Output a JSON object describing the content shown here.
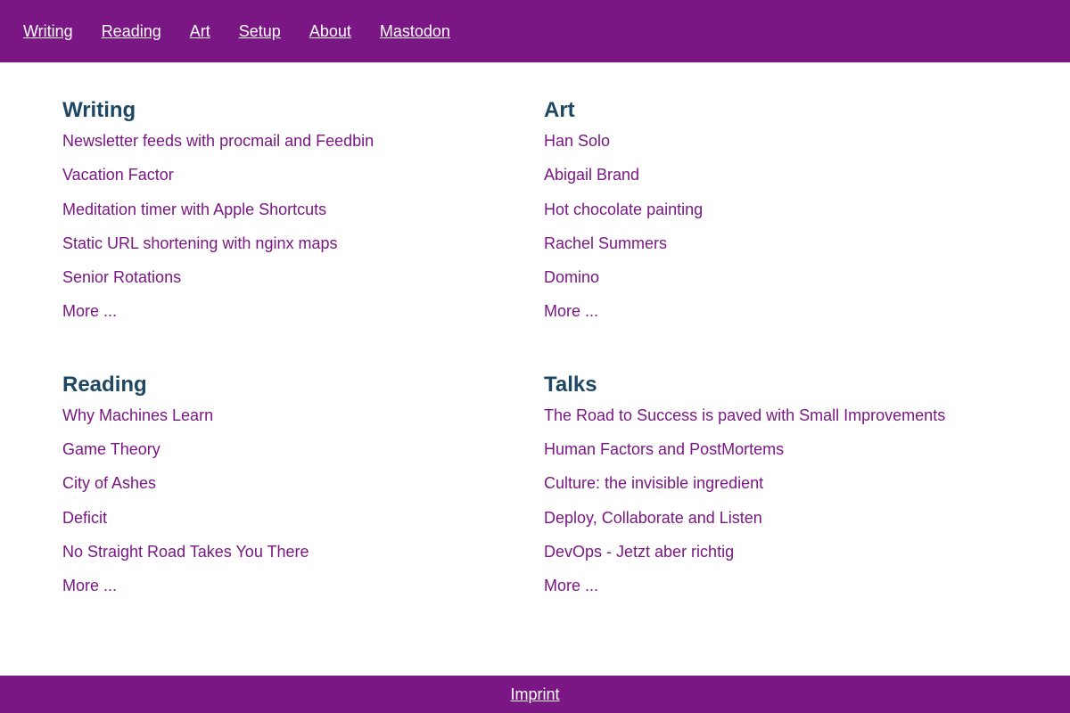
{
  "nav": {
    "items": [
      {
        "label": "Writing"
      },
      {
        "label": "Reading"
      },
      {
        "label": "Art"
      },
      {
        "label": "Setup"
      },
      {
        "label": "About"
      },
      {
        "label": "Mastodon"
      }
    ]
  },
  "sections": {
    "writing": {
      "title": "Writing",
      "items": [
        "Newsletter feeds with procmail and Feedbin",
        "Vacation Factor",
        "Meditation timer with Apple Shortcuts",
        "Static URL shortening with nginx maps",
        "Senior Rotations"
      ],
      "more": "More ..."
    },
    "art": {
      "title": "Art",
      "items": [
        "Han Solo",
        "Abigail Brand",
        "Hot chocolate painting",
        "Rachel Summers",
        "Domino"
      ],
      "more": "More ..."
    },
    "reading": {
      "title": "Reading",
      "items": [
        "Why Machines Learn",
        "Game Theory",
        "City of Ashes",
        "Deficit",
        "No Straight Road Takes You There"
      ],
      "more": "More ..."
    },
    "talks": {
      "title": "Talks",
      "items": [
        "The Road to Success is paved with Small Improvements",
        "Human Factors and PostMortems",
        "Culture: the invisible ingredient",
        "Deploy, Collaborate and Listen",
        "DevOps - Jetzt aber richtig"
      ],
      "more": "More ..."
    }
  },
  "footer": {
    "imprint": "Imprint"
  },
  "colors": {
    "brand": "#7b1785",
    "heading": "#1d4763",
    "link": "#7b1785"
  }
}
